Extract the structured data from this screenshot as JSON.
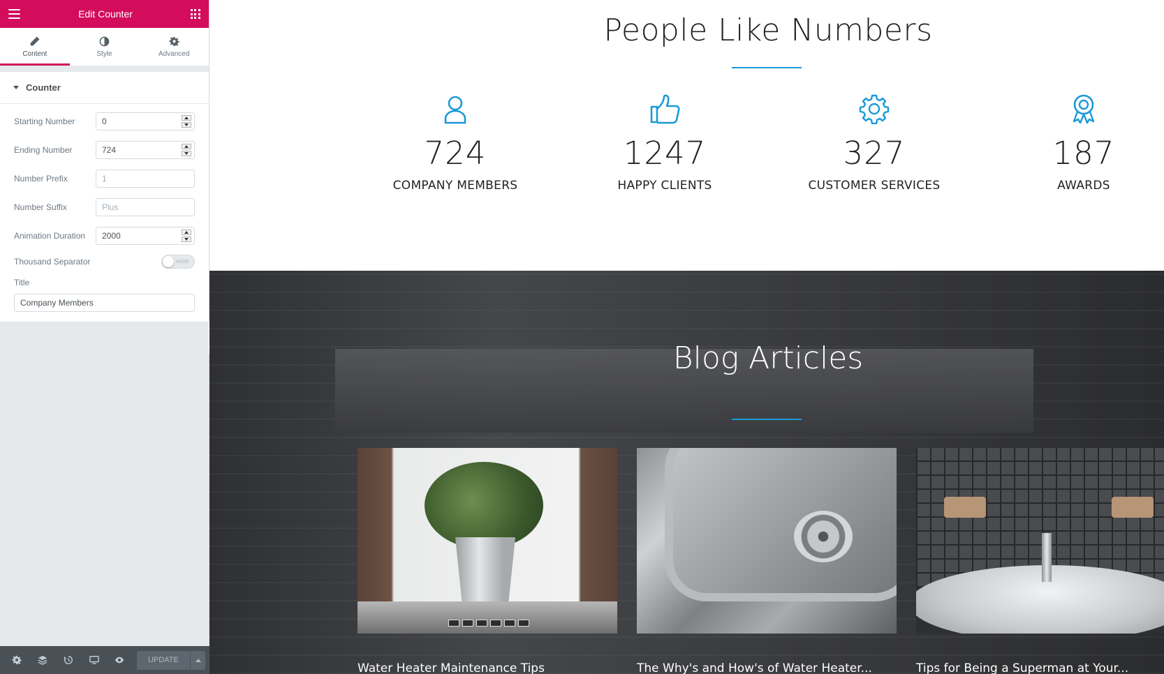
{
  "editor": {
    "header_title": "Edit Counter",
    "tabs": [
      {
        "label": "Content",
        "icon": "pencil-icon"
      },
      {
        "label": "Style",
        "icon": "contrast-icon"
      },
      {
        "label": "Advanced",
        "icon": "gear-icon"
      }
    ],
    "section_title": "Counter",
    "controls": {
      "starting_number": {
        "label": "Starting Number",
        "value": "0"
      },
      "ending_number": {
        "label": "Ending Number",
        "value": "724"
      },
      "number_prefix": {
        "label": "Number Prefix",
        "placeholder": "1"
      },
      "number_suffix": {
        "label": "Number Suffix",
        "placeholder": "Plus"
      },
      "animation_duration": {
        "label": "Animation Duration",
        "value": "2000"
      },
      "thousand_separator": {
        "label": "Thousand Separator",
        "toggle_text": "HIDE",
        "enabled": false
      },
      "title": {
        "label": "Title",
        "value": "Company Members"
      }
    },
    "footer": {
      "update_label": "UPDATE",
      "icons": [
        "gear-icon",
        "layers-icon",
        "history-icon",
        "desktop-icon",
        "eye-icon"
      ]
    },
    "accent_color": "#d30c5c"
  },
  "page": {
    "stats_heading": "People Like Numbers",
    "counters": [
      {
        "number": "724",
        "label": "COMPANY MEMBERS",
        "icon": "user-icon"
      },
      {
        "number": "1247",
        "label": "HAPPY CLIENTS",
        "icon": "thumbs-up-icon"
      },
      {
        "number": "327",
        "label": "CUSTOMER SERVICES",
        "icon": "gear-icon"
      },
      {
        "number": "187",
        "label": "AWARDS",
        "icon": "award-icon"
      }
    ],
    "blog_heading": "Blog Articles",
    "articles": [
      {
        "title": "Water Heater Maintenance Tips"
      },
      {
        "title": "The Why's and How's of Water Heater..."
      },
      {
        "title": "Tips for Being a Superman at Your..."
      }
    ],
    "accent_color": "#1a9ad6"
  }
}
